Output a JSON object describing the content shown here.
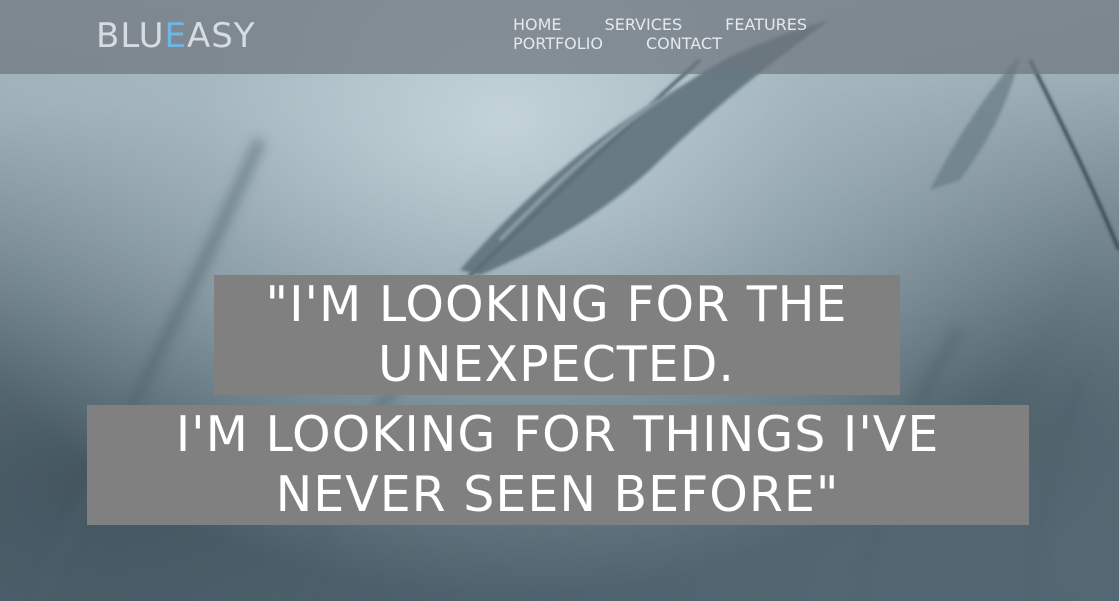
{
  "brand": {
    "logo_prefix": "BLU",
    "logo_accent": "E",
    "logo_suffix": "ASY",
    "accent_color": "#6fb6e3"
  },
  "nav": {
    "items": [
      {
        "label": "HOME"
      },
      {
        "label": "SERVICES"
      },
      {
        "label": "FEATURES"
      },
      {
        "label": "PORTFOLIO"
      },
      {
        "label": "CONTACT"
      }
    ]
  },
  "hero": {
    "quote_line_1": "\"I'M LOOKING FOR THE UNEXPECTED.",
    "quote_line_2": "I'M LOOKING FOR THINGS I'VE NEVER SEEN BEFORE\""
  }
}
